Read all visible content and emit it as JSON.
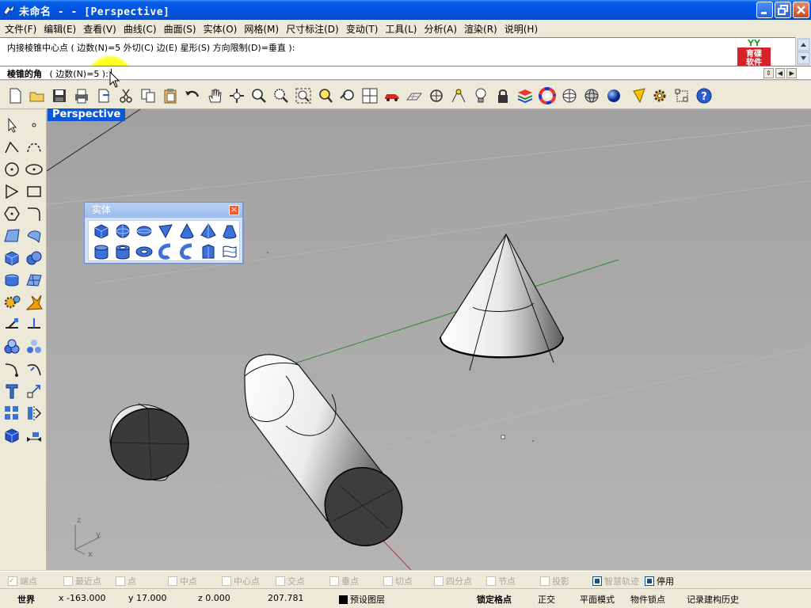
{
  "window": {
    "title": "未命名 -  - [Perspective]"
  },
  "menu": [
    "文件(F)",
    "编辑(E)",
    "查看(V)",
    "曲线(C)",
    "曲面(S)",
    "实体(O)",
    "网格(M)",
    "尺寸标注(D)",
    "变动(T)",
    "工具(L)",
    "分析(A)",
    "渲染(R)",
    "说明(H)"
  ],
  "command_history": {
    "line": "内接棱锥中心点 ( 边数(N)=5  外切(C)  边(E)  星形(S)  方向限制(D)=垂直 ):"
  },
  "logo": {
    "top": "YY",
    "line1": "育碟",
    "line2": "软件"
  },
  "command_prompt": {
    "label": "棱锥的角",
    "option": "( 边数(N)=5 ):"
  },
  "viewport": {
    "label": "Perspective",
    "axis_z": "z",
    "axis_y": "y",
    "axis_x": "x"
  },
  "palette": {
    "title": "实体",
    "close": "×"
  },
  "osnaps": [
    {
      "label": "端点",
      "state": "checked-disabled"
    },
    {
      "label": "最近点",
      "state": "off"
    },
    {
      "label": "点",
      "state": "off"
    },
    {
      "label": "中点",
      "state": "off"
    },
    {
      "label": "中心点",
      "state": "off"
    },
    {
      "label": "交点",
      "state": "off"
    },
    {
      "label": "垂点",
      "state": "off"
    },
    {
      "label": "切点",
      "state": "off"
    },
    {
      "label": "四分点",
      "state": "off"
    },
    {
      "label": "节点",
      "state": "off"
    },
    {
      "label": "投影",
      "state": "off"
    },
    {
      "label": "智慧轨迹",
      "state": "on-disabled"
    },
    {
      "label": "停用",
      "state": "on"
    }
  ],
  "status": {
    "cplane": "世界",
    "x": "x -163.000",
    "y": "y 17.000",
    "z": "z 0.000",
    "dist": "207.781",
    "layer": "预设图层",
    "grid_snap": "锁定格点",
    "ortho": "正交",
    "planar": "平面模式",
    "osnap": "物件锁点",
    "history": "记录建构历史"
  },
  "colors": {
    "title_bar": "#0054e3",
    "viewport_bg": "#a9a9a9",
    "viewport_tab": "#0a56d6",
    "highlight": "#ffff00"
  }
}
